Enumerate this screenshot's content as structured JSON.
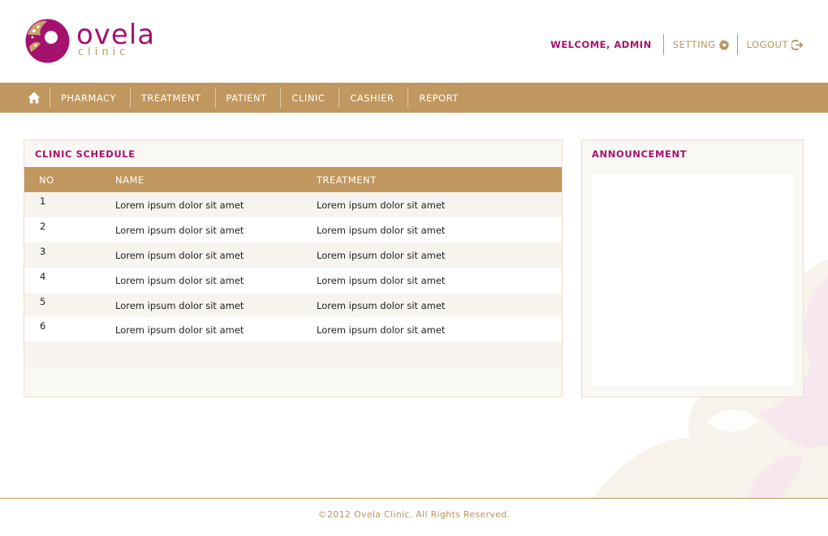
{
  "brand": {
    "name": "ovela",
    "sub": "clinic"
  },
  "topnav": {
    "welcome": "WELCOME, ADMIN",
    "setting": "SETTING",
    "logout": "LOGOUT"
  },
  "mainnav": {
    "items": [
      {
        "label": "PHARMACY"
      },
      {
        "label": "TREATMENT"
      },
      {
        "label": "PATIENT"
      },
      {
        "label": "CLINIC"
      },
      {
        "label": "CASHIER"
      },
      {
        "label": "REPORT"
      }
    ]
  },
  "schedule": {
    "title": "CLINIC SCHEDULE",
    "columns": [
      "NO",
      "NAME",
      "TREATMENT"
    ],
    "rows": [
      {
        "no": "1",
        "name": "Lorem ipsum dolor sit amet",
        "treatment": "Lorem ipsum dolor sit amet"
      },
      {
        "no": "2",
        "name": "Lorem ipsum dolor sit amet",
        "treatment": "Lorem ipsum dolor sit amet"
      },
      {
        "no": "3",
        "name": "Lorem ipsum dolor sit amet",
        "treatment": "Lorem ipsum dolor sit amet"
      },
      {
        "no": "4",
        "name": "Lorem ipsum dolor sit amet",
        "treatment": "Lorem ipsum dolor sit amet"
      },
      {
        "no": "5",
        "name": "Lorem ipsum dolor sit amet",
        "treatment": "Lorem ipsum dolor sit amet"
      },
      {
        "no": "6",
        "name": "Lorem ipsum dolor sit amet",
        "treatment": "Lorem ipsum dolor sit amet"
      }
    ]
  },
  "announcement": {
    "title": "ANNOUNCEMENT"
  },
  "footer": {
    "text": "©2012 Ovela Clinic. All Rights Reserved."
  },
  "icons": {
    "home": "home-icon",
    "setting": "gear-icon",
    "logout": "logout-icon"
  },
  "colors": {
    "brand_magenta": "#a5126e",
    "brand_gold": "#c0975e",
    "panel_bg": "#faf8f5"
  }
}
